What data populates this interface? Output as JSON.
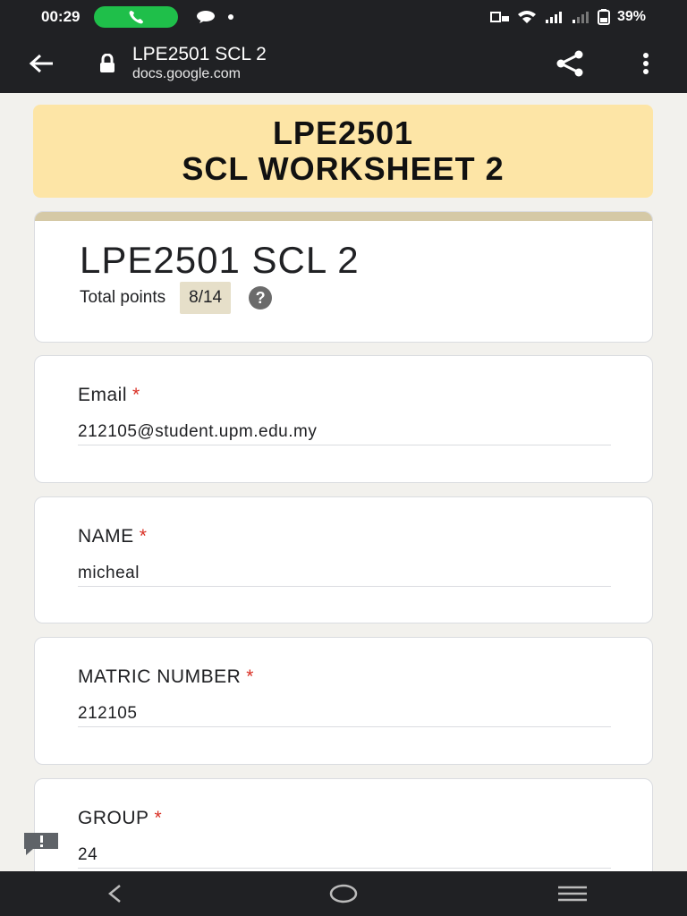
{
  "status": {
    "time": "00:29",
    "battery": "39%",
    "colors": {
      "call_pill": "#1fbf4a"
    }
  },
  "browser": {
    "page_title": "LPE2501 SCL 2",
    "domain": "docs.google.com"
  },
  "banner": {
    "line1": "LPE2501",
    "line2": "SCL WORKSHEET 2",
    "color": "#fde5a6"
  },
  "form": {
    "title": "LPE2501 SCL 2",
    "total_points_label": "Total points",
    "total_points_value": "8/14",
    "help_glyph": "?"
  },
  "questions": [
    {
      "label": "Email",
      "required_mark": "*",
      "answer": "212105@student.upm.edu.my"
    },
    {
      "label": "NAME",
      "required_mark": "*",
      "answer": "micheal"
    },
    {
      "label": "MATRIC NUMBER",
      "required_mark": "*",
      "answer": "212105"
    },
    {
      "label": "GROUP",
      "required_mark": "*",
      "answer": "24"
    }
  ],
  "icons": {
    "back": "arrow-left-icon",
    "lock": "lock-icon",
    "share": "share-icon",
    "menu": "more-vert-icon",
    "feedback": "feedback-icon",
    "nav_back": "nav-back-icon",
    "nav_home": "nav-home-icon",
    "nav_recents": "nav-recents-icon"
  }
}
